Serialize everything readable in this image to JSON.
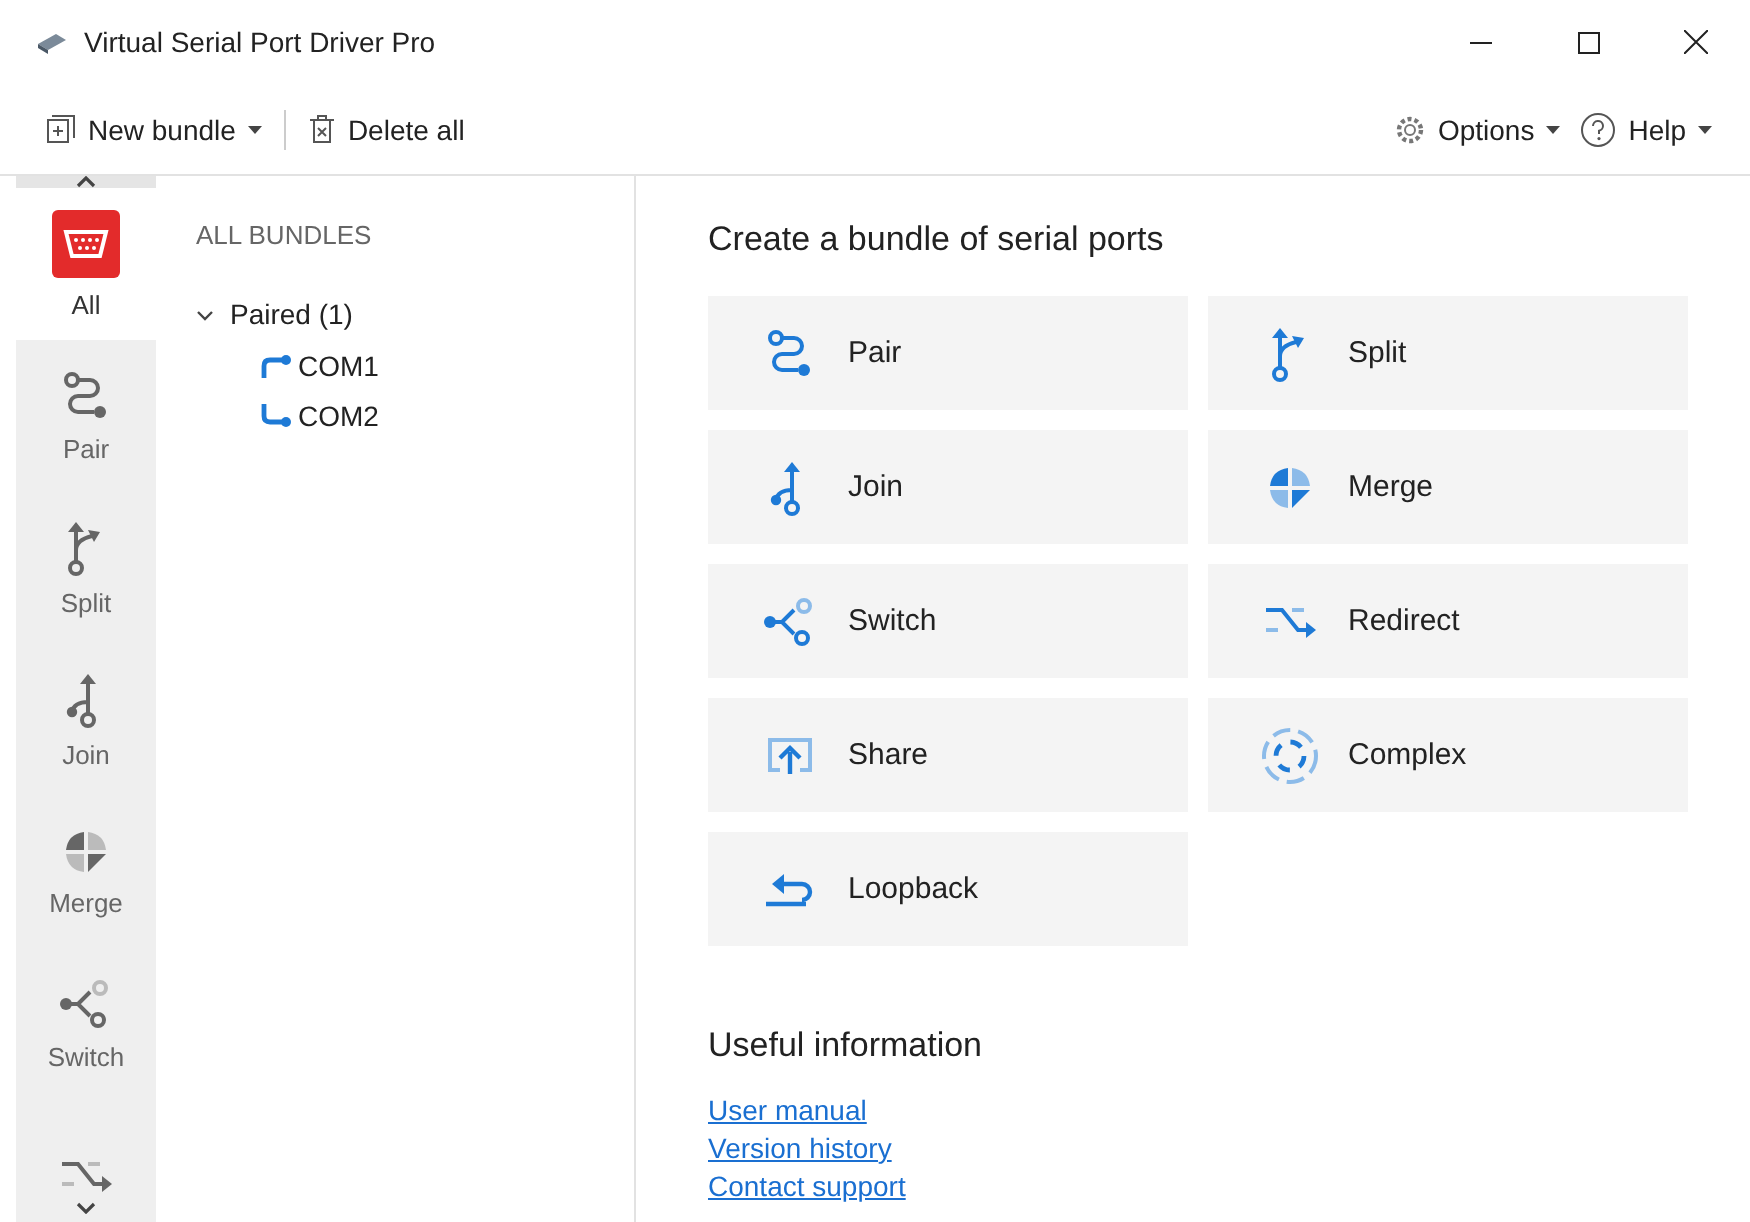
{
  "window": {
    "title": "Virtual Serial Port Driver Pro"
  },
  "toolbar": {
    "left": [
      {
        "label": "New bundle",
        "kind": "new",
        "dropdown": true
      },
      {
        "label": "Delete all",
        "kind": "delete",
        "dropdown": false
      }
    ],
    "right": [
      {
        "label": "Options",
        "kind": "options",
        "dropdown": true
      },
      {
        "label": "Help",
        "kind": "help",
        "dropdown": true
      }
    ]
  },
  "sidebar": {
    "items": [
      {
        "label": "All",
        "kind": "all",
        "selected": true
      },
      {
        "label": "Pair",
        "kind": "pair",
        "selected": false
      },
      {
        "label": "Split",
        "kind": "split",
        "selected": false
      },
      {
        "label": "Join",
        "kind": "join",
        "selected": false
      },
      {
        "label": "Merge",
        "kind": "merge",
        "selected": false
      },
      {
        "label": "Switch",
        "kind": "switch",
        "selected": false
      },
      {
        "kind": "redirect",
        "selected": false
      }
    ]
  },
  "bundles": {
    "heading": "ALL BUNDLES",
    "tree": [
      {
        "label": "Paired (1)",
        "expanded": true,
        "children": [
          {
            "label": "COM1",
            "kind": "out"
          },
          {
            "label": "COM2",
            "kind": "in"
          }
        ]
      }
    ]
  },
  "create": {
    "title": "Create a bundle of serial ports",
    "cards": [
      {
        "label": "Pair",
        "kind": "pair"
      },
      {
        "label": "Split",
        "kind": "split"
      },
      {
        "label": "Join",
        "kind": "join"
      },
      {
        "label": "Merge",
        "kind": "merge"
      },
      {
        "label": "Switch",
        "kind": "switch"
      },
      {
        "label": "Redirect",
        "kind": "redirect"
      },
      {
        "label": "Share",
        "kind": "share"
      },
      {
        "label": "Complex",
        "kind": "complex"
      },
      {
        "label": "Loopback",
        "kind": "loopback"
      }
    ]
  },
  "info": {
    "title": "Useful information",
    "links": [
      "User manual",
      "Version history",
      "Contact support"
    ]
  }
}
